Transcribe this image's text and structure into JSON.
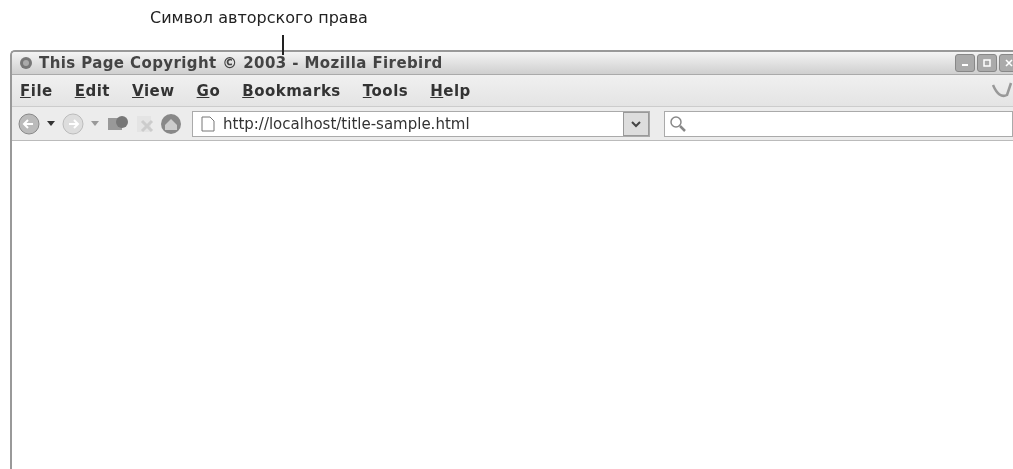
{
  "annotation": {
    "label": "Символ авторского права"
  },
  "window": {
    "title": "This Page Copyright © 2003 - Mozilla Firebird"
  },
  "menu": [
    "File",
    "Edit",
    "View",
    "Go",
    "Bookmarks",
    "Tools",
    "Help"
  ],
  "address_bar": {
    "value": "http://localhost/title-sample.html"
  }
}
